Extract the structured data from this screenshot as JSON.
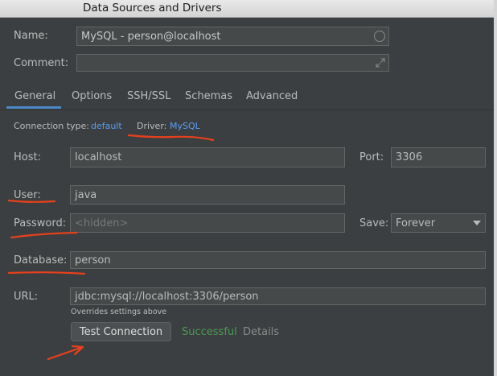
{
  "window": {
    "title": "Data Sources and Drivers"
  },
  "form": {
    "name_label": "Name:",
    "name_value": "MySQL - person@localhost",
    "comment_label": "Comment:",
    "comment_value": ""
  },
  "tabs": [
    {
      "label": "General",
      "active": true
    },
    {
      "label": "Options"
    },
    {
      "label": "SSH/SSL"
    },
    {
      "label": "Schemas"
    },
    {
      "label": "Advanced"
    }
  ],
  "connection": {
    "type_label": "Connection type:",
    "type_value": "default",
    "driver_label": "Driver:",
    "driver_value": "MySQL"
  },
  "host": {
    "label": "Host:",
    "value": "localhost"
  },
  "port": {
    "label": "Port:",
    "value": "3306"
  },
  "user": {
    "label": "User:",
    "value": "java"
  },
  "password": {
    "label": "Password:",
    "placeholder": "<hidden>"
  },
  "save": {
    "label": "Save:",
    "value": "Forever"
  },
  "database": {
    "label": "Database:",
    "value": "person"
  },
  "url": {
    "label": "URL:",
    "value": "jdbc:mysql://localhost:3306/person",
    "hint": "Overrides settings above"
  },
  "test": {
    "button_label": "Test Connection",
    "status": "Successful",
    "details_link": "Details"
  },
  "colors": {
    "background": "#3c3f41",
    "field_bg": "#45494a",
    "link": "#589df6",
    "success": "#499c54",
    "annotation": "#e8401c",
    "tab_underline": "#4a88c7"
  },
  "icons": {
    "name_field_icon": "circle-icon",
    "comment_expand_icon": "expand-arrows-icon",
    "save_dropdown_icon": "triangle-down-icon"
  }
}
